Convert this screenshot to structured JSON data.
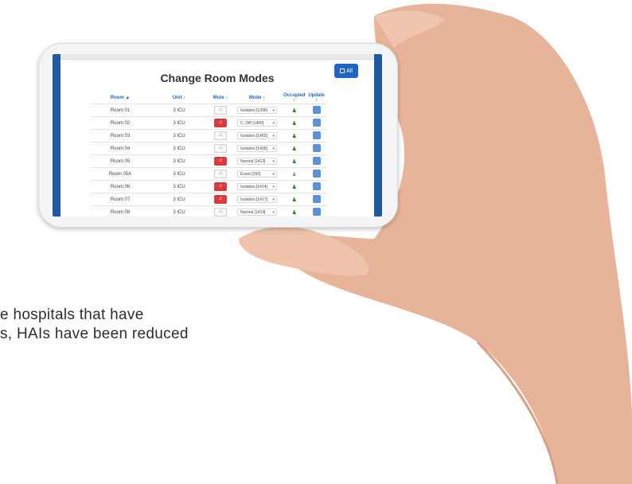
{
  "screen": {
    "title": "Change Room Modes",
    "all_button_label": "All",
    "columns": {
      "room": "Room",
      "unit": "Unit",
      "mute": "Mute",
      "mode": "Mode",
      "occupied": "Occupied",
      "update": "Update"
    },
    "rows": [
      {
        "room": "Room 01",
        "unit": "3 ICU",
        "mute_red": false,
        "mode": "Isolation [1396]",
        "occupied": true
      },
      {
        "room": "Room 02",
        "unit": "3 ICU",
        "mute_red": true,
        "mode": "C. Diff [1400]",
        "occupied": true
      },
      {
        "room": "Room 03",
        "unit": "3 ICU",
        "mute_red": false,
        "mode": "Isolation [1402]",
        "occupied": true
      },
      {
        "room": "Room 04",
        "unit": "3 ICU",
        "mute_red": false,
        "mode": "Isolation [1405]",
        "occupied": true
      },
      {
        "room": "Room 05",
        "unit": "3 ICU",
        "mute_red": true,
        "mode": "Normal [1413]",
        "occupied": true
      },
      {
        "room": "Room 05A",
        "unit": "3 ICU",
        "mute_red": false,
        "mode": "Event [292]",
        "occupied": false
      },
      {
        "room": "Room 06",
        "unit": "3 ICU",
        "mute_red": true,
        "mode": "Isolation [1414]",
        "occupied": true
      },
      {
        "room": "Room 07",
        "unit": "3 ICU",
        "mute_red": true,
        "mode": "Isolation [1417]",
        "occupied": true
      },
      {
        "room": "Room 08",
        "unit": "3 ICU",
        "mute_red": false,
        "mode": "Normal [1419]",
        "occupied": true
      }
    ]
  },
  "paragraph": {
    "line1": "e hospitals that have",
    "line2": "s, HAIs have been reduced"
  },
  "colors": {
    "accent": "#1f66c4",
    "mute_active": "#d83b3b",
    "occupied": "#2f7a2f"
  }
}
